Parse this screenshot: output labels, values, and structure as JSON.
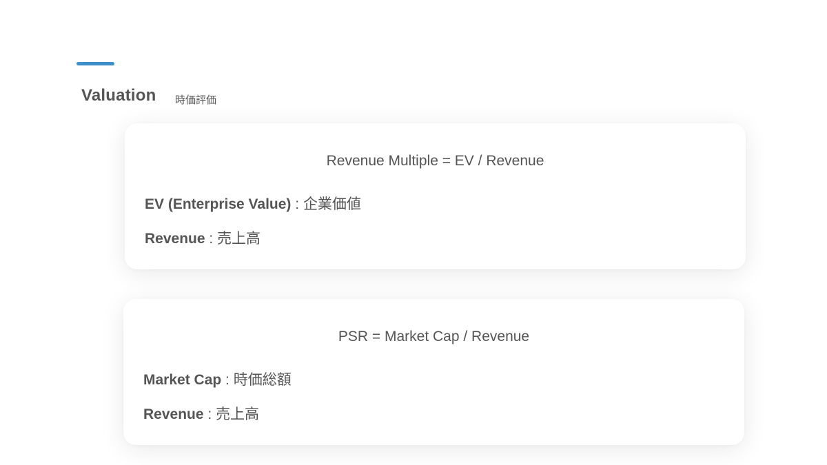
{
  "header": {
    "title": "Valuation",
    "subtitle": "時価評価",
    "accent_color": "#3d8fc9"
  },
  "cards": [
    {
      "formula": "Revenue Multiple = EV / Revenue",
      "definitions": [
        {
          "term": "EV (Enterprise Value)",
          "separator": " : ",
          "meaning": "企業価値"
        },
        {
          "term": "Revenue",
          "separator": " : ",
          "meaning": "売上高"
        }
      ]
    },
    {
      "formula": "PSR = Market Cap / Revenue",
      "definitions": [
        {
          "term": "Market Cap",
          "separator": " : ",
          "meaning": "時価総額"
        },
        {
          "term": "Revenue",
          "separator": " : ",
          "meaning": "売上高"
        }
      ]
    }
  ]
}
